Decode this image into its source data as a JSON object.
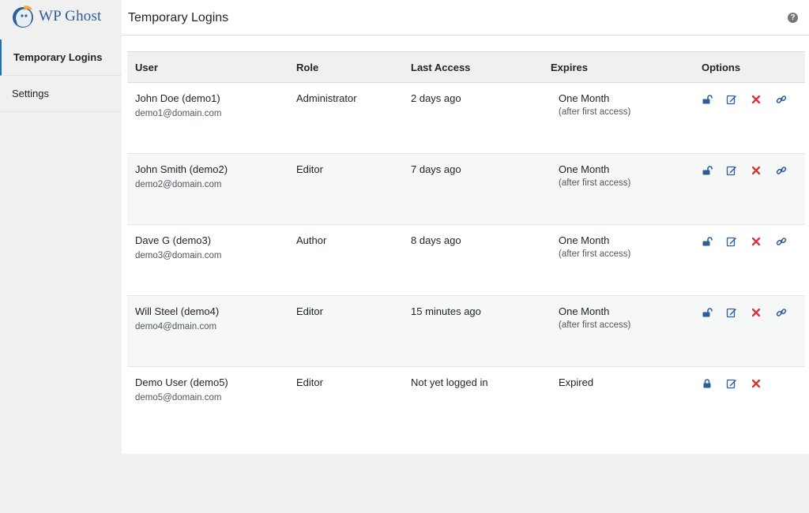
{
  "brand": {
    "name": "WP Ghost"
  },
  "colors": {
    "accent": "#2271b1",
    "icon_blue": "#2f5d9a",
    "delete_red": "#d63638"
  },
  "sidebar": {
    "items": [
      {
        "label": "Temporary Logins",
        "active": true
      },
      {
        "label": "Settings",
        "active": false
      }
    ]
  },
  "header": {
    "title": "Temporary Logins",
    "help_icon": "question-circle-icon"
  },
  "table": {
    "columns": [
      "User",
      "Role",
      "Last Access",
      "Expires",
      "Options"
    ],
    "rows": [
      {
        "user": "John Doe (demo1)",
        "email": "demo1@domain.com",
        "role": "Administrator",
        "last_access": "2 days ago",
        "expires": "One Month",
        "expires_note": "(after first access)",
        "lock_state": "unlocked"
      },
      {
        "user": "John Smith (demo2)",
        "email": "demo2@domain.com",
        "role": "Editor",
        "last_access": "7 days ago",
        "expires": "One Month",
        "expires_note": "(after first access)",
        "lock_state": "unlocked"
      },
      {
        "user": "Dave G (demo3)",
        "email": "demo3@domain.com",
        "role": "Author",
        "last_access": "8 days ago",
        "expires": "One Month",
        "expires_note": "(after first access)",
        "lock_state": "unlocked"
      },
      {
        "user": "Will Steel (demo4)",
        "email": "demo4@dmain.com",
        "role": "Editor",
        "last_access": "15 minutes ago",
        "expires": "One Month",
        "expires_note": "(after first access)",
        "lock_state": "unlocked"
      },
      {
        "user": "Demo User (demo5)",
        "email": "demo5@domain.com",
        "role": "Editor",
        "last_access": "Not yet logged in",
        "expires": "Expired",
        "expires_note": "",
        "lock_state": "locked"
      }
    ],
    "option_icons": [
      "lock-icon",
      "edit-icon",
      "delete-icon",
      "link-icon"
    ]
  }
}
